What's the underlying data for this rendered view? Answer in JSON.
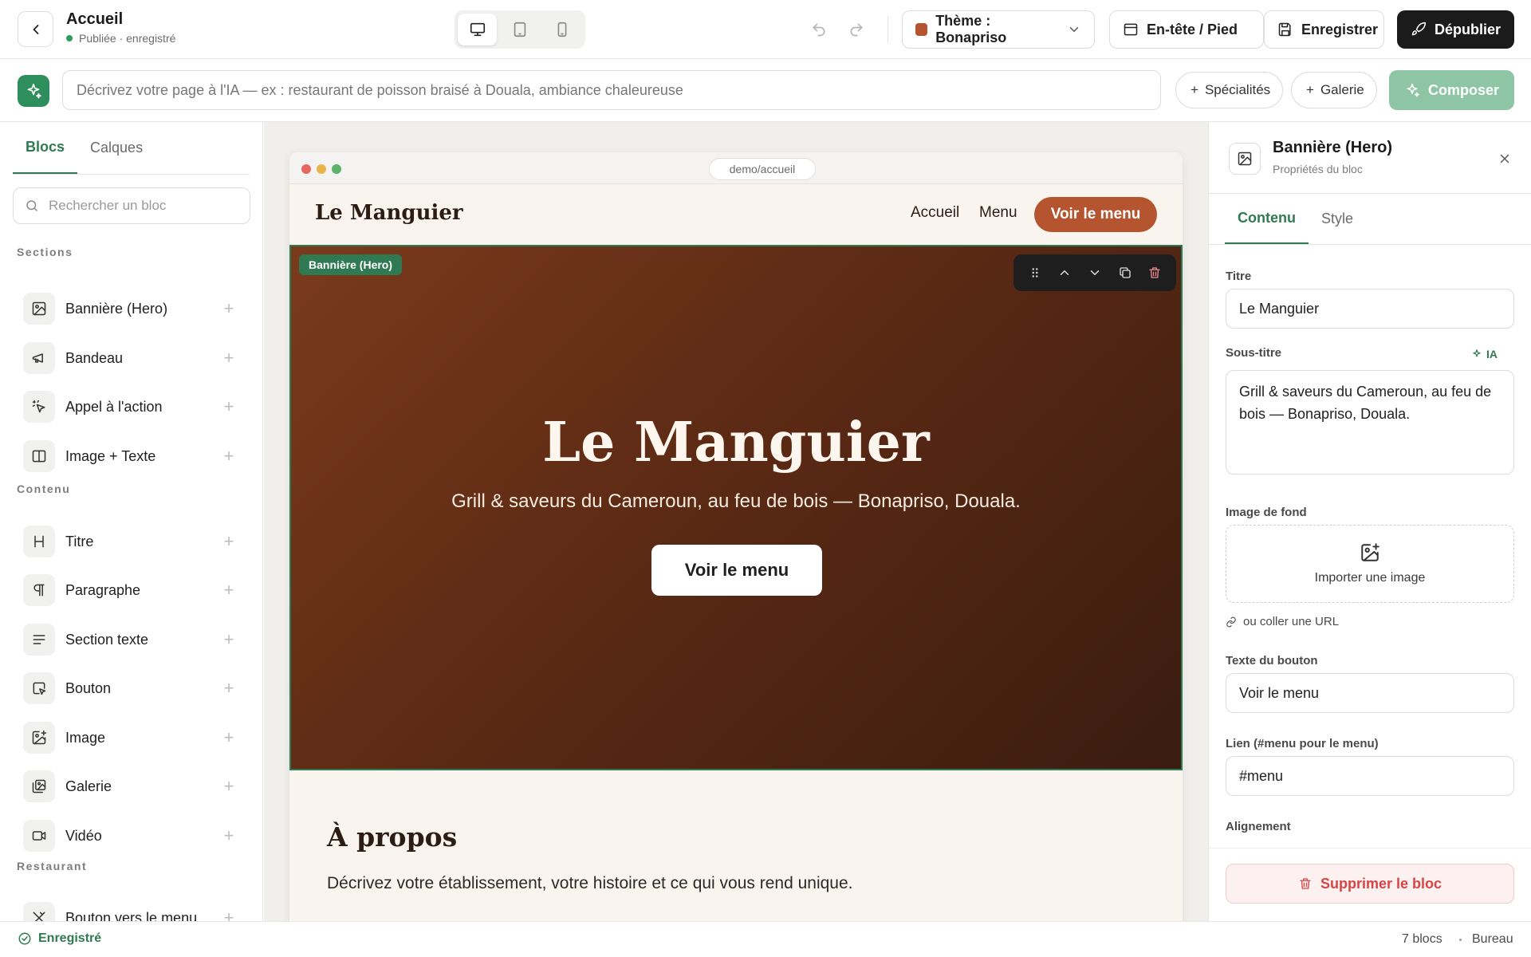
{
  "header": {
    "page_name": "Accueil",
    "page_status": "Publiée · enregistré",
    "devices": [
      "desktop",
      "tablet",
      "mobile"
    ],
    "theme_label": "Thème : Bonapriso",
    "theme_color": "#b55530",
    "header_footer_label": "En-tête / Pied",
    "save_label": "Enregistrer",
    "publish_label": "Dépublier"
  },
  "ai_bar": {
    "placeholder": "Décrivez votre page à l'IA — ex : restaurant de poisson braisé à Douala, ambiance chaleureuse",
    "chips": [
      "Spécialités",
      "Galerie"
    ],
    "compose_label": "Composer"
  },
  "sidebar": {
    "tabs": [
      "Blocs",
      "Calques"
    ],
    "search_placeholder": "Rechercher un bloc",
    "groups": [
      {
        "label": "Sections",
        "items": [
          {
            "label": "Bannière (Hero)",
            "icon": "image-icon"
          },
          {
            "label": "Bandeau",
            "icon": "megaphone-icon"
          },
          {
            "label": "Appel à l'action",
            "icon": "click-icon"
          },
          {
            "label": "Image + Texte",
            "icon": "columns-icon"
          }
        ]
      },
      {
        "label": "Contenu",
        "items": [
          {
            "label": "Titre",
            "icon": "heading-icon"
          },
          {
            "label": "Paragraphe",
            "icon": "pilcrow-icon"
          },
          {
            "label": "Section texte",
            "icon": "text-lines-icon"
          },
          {
            "label": "Bouton",
            "icon": "button-icon"
          },
          {
            "label": "Image",
            "icon": "image-plus-icon"
          },
          {
            "label": "Galerie",
            "icon": "gallery-icon"
          },
          {
            "label": "Vidéo",
            "icon": "video-icon"
          }
        ]
      },
      {
        "label": "Restaurant",
        "items": [
          {
            "label": "Bouton vers le menu",
            "icon": "utensils-icon"
          }
        ]
      }
    ]
  },
  "canvas": {
    "url": "demo/accueil",
    "site": {
      "logo": "Le Manguier",
      "nav_links": [
        "Accueil",
        "Menu"
      ],
      "cta": "Voir le menu"
    },
    "hero": {
      "tag": "Bannière (Hero)",
      "title": "Le Manguier",
      "subtitle": "Grill & saveurs du Cameroun, au feu de bois — Bonapriso, Douala.",
      "button": "Voir le menu"
    },
    "about": {
      "title": "À propos",
      "text": "Décrivez votre établissement, votre histoire et ce qui vous rend unique."
    }
  },
  "properties": {
    "title": "Bannière (Hero)",
    "subtitle": "Propriétés du bloc",
    "tabs": [
      "Contenu",
      "Style"
    ],
    "fields": {
      "title_label": "Titre",
      "title_value": "Le Manguier",
      "subtitle_label": "Sous-titre",
      "ai_label": "IA",
      "subtitle_value": "Grill & saveurs du Cameroun, au feu de bois — Bonapriso, Douala.",
      "bg_label": "Image de fond",
      "upload_label": "Importer une image",
      "url_link": "ou coller une URL",
      "button_label": "Texte du bouton",
      "button_value": "Voir le menu",
      "link_label": "Lien (#menu pour le menu)",
      "link_value": "#menu",
      "align_label": "Alignement"
    },
    "delete_label": "Supprimer le bloc"
  },
  "statusbar": {
    "saved": "Enregistré",
    "block_count": "7 blocs",
    "viewport": "Bureau"
  },
  "colors": {
    "accent": "#2f7a52",
    "brand": "#b55530",
    "danger": "#d64545"
  }
}
